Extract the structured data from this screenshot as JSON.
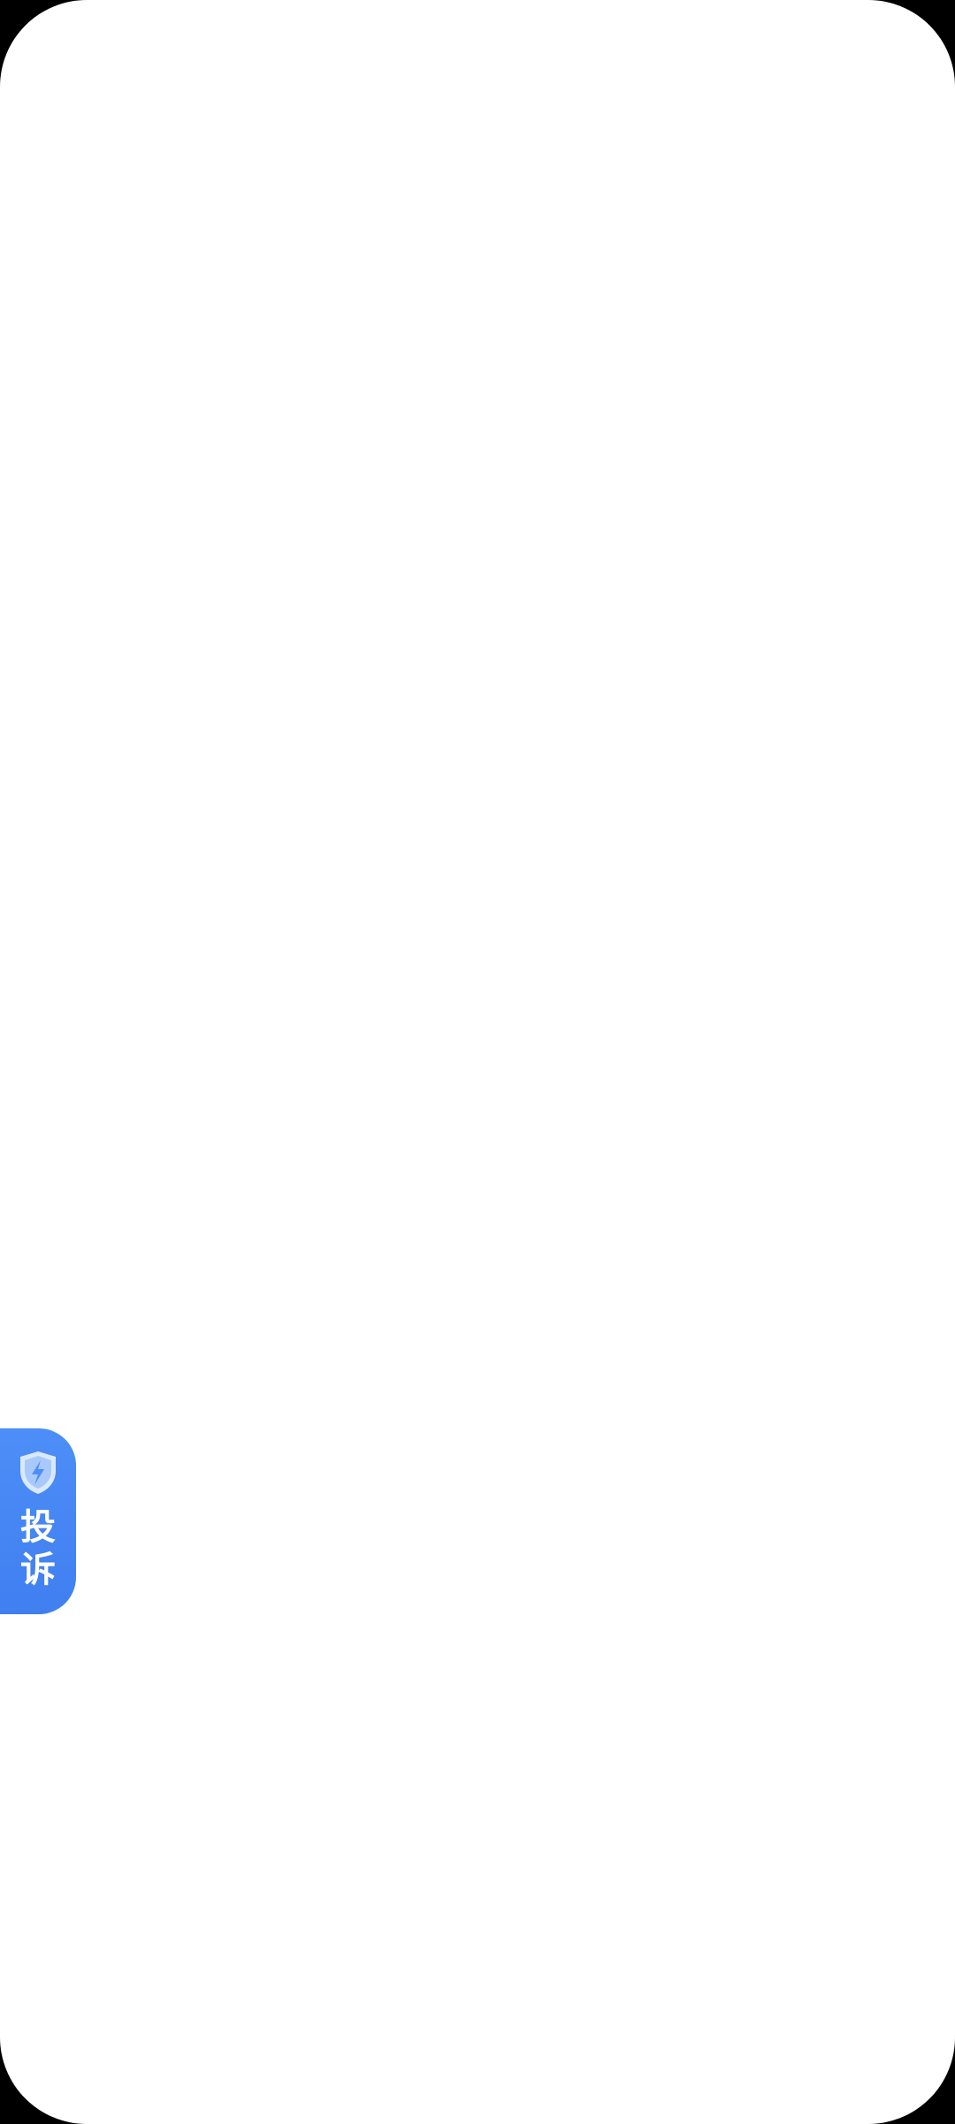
{
  "screen": {
    "background_color": "#ffffff",
    "frame_color": "#000000"
  },
  "complaint_tab": {
    "label": "投诉",
    "icon": "shield-lightning-icon",
    "accent_color": "#4285f4"
  }
}
